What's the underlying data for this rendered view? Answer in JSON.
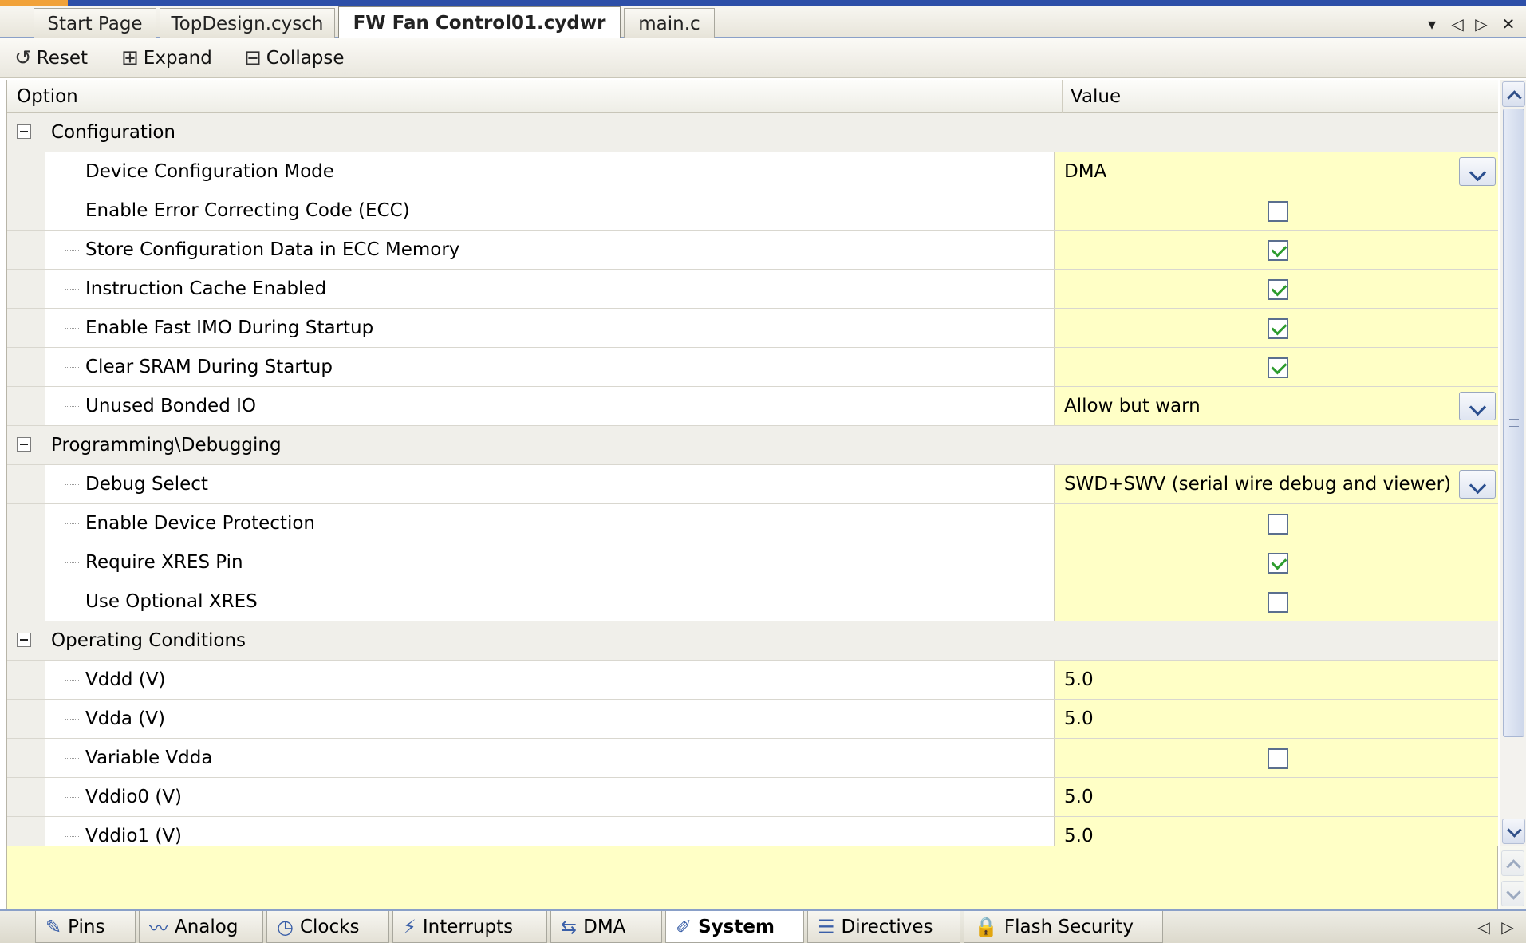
{
  "tabs": [
    {
      "label": "Start Page",
      "active": false
    },
    {
      "label": "TopDesign.cysch",
      "active": false
    },
    {
      "label": "FW Fan Control01.cydwr",
      "active": true
    },
    {
      "label": "main.c",
      "active": false
    }
  ],
  "tab_controls": {
    "dropdown": "▾",
    "prev": "◁",
    "next": "▷",
    "close": "✕"
  },
  "toolbar": {
    "reset": "Reset",
    "expand": "Expand",
    "collapse": "Collapse"
  },
  "grid": {
    "col_option": "Option",
    "col_value": "Value",
    "rows": [
      {
        "kind": "category",
        "label": "Configuration"
      },
      {
        "kind": "option",
        "label": "Device Configuration Mode",
        "type": "dropdown",
        "value": "DMA"
      },
      {
        "kind": "option",
        "label": "Enable Error Correcting Code (ECC)",
        "type": "checkbox",
        "checked": false
      },
      {
        "kind": "option",
        "label": "Store Configuration Data in ECC Memory",
        "type": "checkbox",
        "checked": true
      },
      {
        "kind": "option",
        "label": "Instruction Cache Enabled",
        "type": "checkbox",
        "checked": true
      },
      {
        "kind": "option",
        "label": "Enable Fast IMO During Startup",
        "type": "checkbox",
        "checked": true
      },
      {
        "kind": "option",
        "label": "Clear SRAM During Startup",
        "type": "checkbox",
        "checked": true
      },
      {
        "kind": "option",
        "label": "Unused Bonded IO",
        "type": "dropdown",
        "value": "Allow but warn"
      },
      {
        "kind": "category",
        "label": "Programming\\Debugging"
      },
      {
        "kind": "option",
        "label": "Debug Select",
        "type": "dropdown",
        "value": "SWD+SWV (serial wire debug and viewer)"
      },
      {
        "kind": "option",
        "label": "Enable Device Protection",
        "type": "checkbox",
        "checked": false
      },
      {
        "kind": "option",
        "label": "Require XRES Pin",
        "type": "checkbox",
        "checked": true
      },
      {
        "kind": "option",
        "label": "Use Optional XRES",
        "type": "checkbox",
        "checked": false
      },
      {
        "kind": "category",
        "label": "Operating Conditions"
      },
      {
        "kind": "option",
        "label": "Vddd (V)",
        "type": "text",
        "value": "5.0"
      },
      {
        "kind": "option",
        "label": "Vdda (V)",
        "type": "text",
        "value": "5.0"
      },
      {
        "kind": "option",
        "label": "Variable Vdda",
        "type": "checkbox",
        "checked": false
      },
      {
        "kind": "option",
        "label": "Vddio0 (V)",
        "type": "text",
        "value": "5.0"
      },
      {
        "kind": "option",
        "label": "Vddio1 (V)",
        "type": "text",
        "value": "5.0"
      }
    ]
  },
  "bottom_tabs": [
    {
      "label": "Pins",
      "icon": "pins-icon",
      "glyph": "✎",
      "active": false
    },
    {
      "label": "Analog",
      "icon": "analog-icon",
      "glyph": "〰",
      "active": false
    },
    {
      "label": "Clocks",
      "icon": "clock-icon",
      "glyph": "◷",
      "active": false
    },
    {
      "label": "Interrupts",
      "icon": "lightning-icon",
      "glyph": "⚡",
      "active": false
    },
    {
      "label": "DMA",
      "icon": "dma-icon",
      "glyph": "⇆",
      "active": false
    },
    {
      "label": "System",
      "icon": "system-icon",
      "glyph": "✐",
      "active": true
    },
    {
      "label": "Directives",
      "icon": "directives-icon",
      "glyph": "☰",
      "active": false
    },
    {
      "label": "Flash Security",
      "icon": "lock-icon",
      "glyph": "🔒",
      "active": false
    }
  ],
  "bottom_nav": {
    "prev": "◁",
    "next": "▷"
  },
  "colors": {
    "value_cell": "#ffffc6",
    "category_row": "#f0efea",
    "accent": "#2d4fa8",
    "check": "#2d9c2d"
  }
}
